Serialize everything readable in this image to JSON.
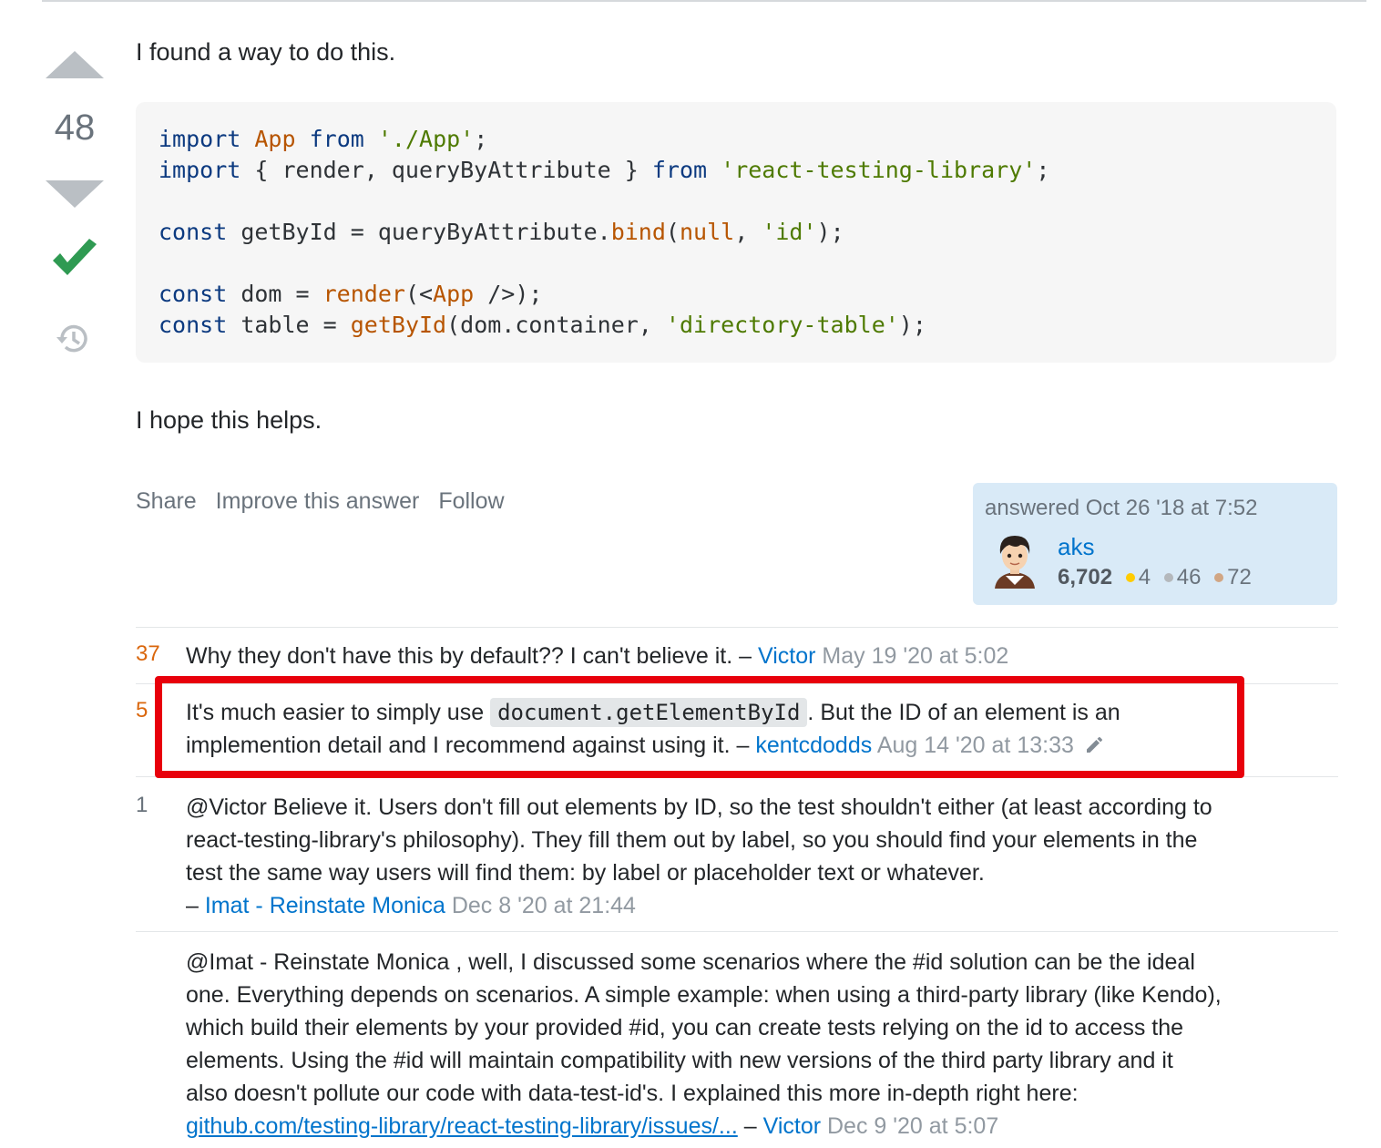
{
  "answer": {
    "score": "48",
    "intro": "I found a way to do this.",
    "code_lines": [
      [
        {
          "t": "import",
          "c": "kw"
        },
        {
          "t": " ",
          "c": "pl"
        },
        {
          "t": "App",
          "c": "ty"
        },
        {
          "t": " ",
          "c": "pl"
        },
        {
          "t": "from",
          "c": "kw"
        },
        {
          "t": " ",
          "c": "pl"
        },
        {
          "t": "'./App'",
          "c": "st"
        },
        {
          "t": ";",
          "c": "pl"
        }
      ],
      [
        {
          "t": "import",
          "c": "kw"
        },
        {
          "t": " { render, queryByAttribute } ",
          "c": "pl"
        },
        {
          "t": "from",
          "c": "kw"
        },
        {
          "t": " ",
          "c": "pl"
        },
        {
          "t": "'react-testing-library'",
          "c": "st"
        },
        {
          "t": ";",
          "c": "pl"
        }
      ],
      [],
      [
        {
          "t": "const",
          "c": "kw"
        },
        {
          "t": " getById = queryByAttribute.",
          "c": "pl"
        },
        {
          "t": "bind",
          "c": "fn"
        },
        {
          "t": "(",
          "c": "pl"
        },
        {
          "t": "null",
          "c": "ty"
        },
        {
          "t": ", ",
          "c": "pl"
        },
        {
          "t": "'id'",
          "c": "st"
        },
        {
          "t": ");",
          "c": "pl"
        }
      ],
      [],
      [
        {
          "t": "const",
          "c": "kw"
        },
        {
          "t": " dom = ",
          "c": "pl"
        },
        {
          "t": "render",
          "c": "fn"
        },
        {
          "t": "(<",
          "c": "pl"
        },
        {
          "t": "App",
          "c": "ty"
        },
        {
          "t": " />);",
          "c": "pl"
        }
      ],
      [
        {
          "t": "const",
          "c": "kw"
        },
        {
          "t": " table = ",
          "c": "pl"
        },
        {
          "t": "getById",
          "c": "fn"
        },
        {
          "t": "(dom.container, ",
          "c": "pl"
        },
        {
          "t": "'directory-table'",
          "c": "st"
        },
        {
          "t": ");",
          "c": "pl"
        }
      ]
    ],
    "outro": "I hope this helps.",
    "menu": {
      "share": "Share",
      "improve": "Improve this answer",
      "follow": "Follow"
    },
    "signature": {
      "answered": "answered Oct 26 '18 at 7:52",
      "user": "aks",
      "reputation": "6,702",
      "gold": "4",
      "silver": "46",
      "bronze": "72"
    }
  },
  "comments": [
    {
      "score": "37",
      "text": "Why they don't have this by default?? I can't believe it. –",
      "user": "Victor",
      "date": "May 19 '20 at 5:02"
    },
    {
      "score": "5",
      "text_before": "It's much easier to simply use",
      "code": "document.getElementById",
      "text_after_line1": ". But the ID of an element is an",
      "text_line2": "implemention detail and I recommend against using it. –",
      "user": "kentcdodds",
      "date": "Aug 14 '20 at 13:33"
    },
    {
      "score": "1",
      "lines": [
        "@Victor Believe it. Users don't fill out elements by ID, so the test shouldn't either (at least according to",
        "react-testing-library's philosophy). They fill them out by label, so you should find your elements in the",
        "test the same way users will find them: by label or placeholder text or whatever."
      ],
      "user": "Imat - Reinstate Monica",
      "date": "Dec 8 '20 at 21:44",
      "prefix": "–"
    },
    {
      "score": "",
      "lines": [
        "@Imat - Reinstate Monica , well, I discussed some scenarios where the #id solution can be the ideal",
        "one. Everything depends on scenarios. A simple example: when using a third-party library (like Kendo),",
        "which build their elements by your provided #id, you can create tests relying on the id to access the",
        "elements. Using the #id will maintain compatibility with new versions of the third party library and it",
        "also doesn't pollute our code with data-test-id's. I explained this more in-depth right here:"
      ],
      "link": "github.com/testing-library/react-testing-library/issues/...",
      "sep": "–",
      "user": "Victor",
      "date": "Dec 9 '20 at 5:07"
    }
  ],
  "colors": {
    "accent": "#0074cc",
    "accepted": "#2f9a52",
    "highlight": "#e8000b",
    "orange_score": "#da670d"
  }
}
